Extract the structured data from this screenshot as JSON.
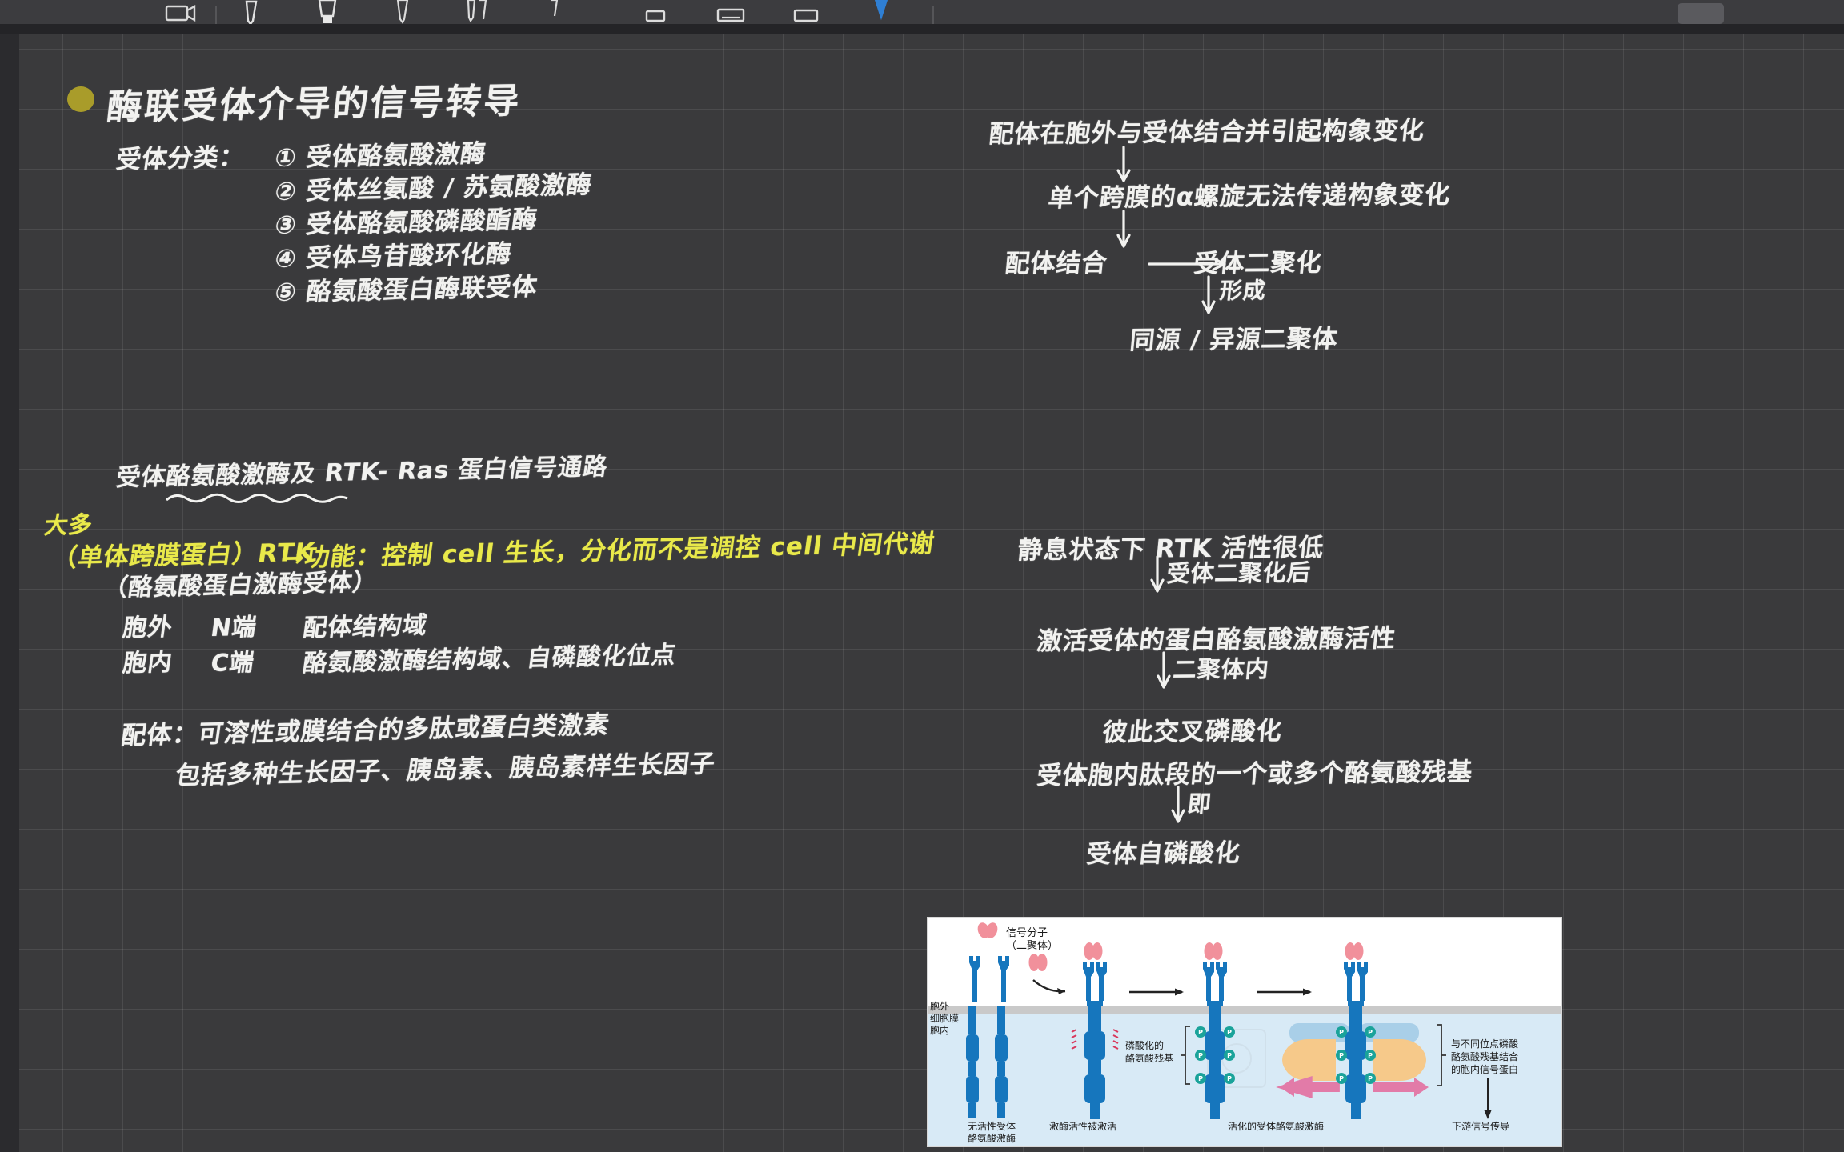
{
  "app": {
    "toolbar": {
      "tools": [
        {
          "name": "camera-icon",
          "label": "Camera"
        },
        {
          "name": "pen-icon",
          "label": "Pen"
        },
        {
          "name": "highlighter-icon",
          "label": "Highlighter"
        },
        {
          "name": "pencil-icon",
          "label": "Pencil"
        },
        {
          "name": "brush-icon",
          "label": "Brush"
        },
        {
          "name": "eraser-icon",
          "label": "Eraser"
        },
        {
          "name": "shape-square-icon",
          "label": "Shape"
        },
        {
          "name": "text-box-icon",
          "label": "Text box"
        },
        {
          "name": "note-icon",
          "label": "Sticky note"
        },
        {
          "name": "lasso-icon",
          "label": "Lasso select"
        }
      ],
      "more_button_label": ""
    },
    "canvas": {
      "background_color": "#3a3a3c",
      "grid_color": "#ffffff15",
      "ink_color": "#f2f2f0",
      "highlight_ink_color": "#e9e94a",
      "bullet_color": "#a99c2a"
    }
  },
  "note": {
    "title": "酶联受体介导的信号转导",
    "left_column": {
      "classification_label": "受体分类：",
      "classification_items": [
        "① 受体酪氨酸激酶",
        "② 受体丝氨酸 / 苏氨酸激酶",
        "③ 受体酪氨酸磷酸酯酶",
        "④ 受体鸟苷酸环化酶",
        "⑤ 酪氨酸蛋白酶联受体"
      ],
      "section_heading": "受体酪氨酸激酶及 RTK- Ras 蛋白信号通路",
      "margin_note": "大多",
      "rtk_line": "（单体跨膜蛋白）RTK",
      "rtk_function": "→功能：控制 cell 生长，分化而不是调控 cell 中间代谢",
      "rtk_subnote": "（酪氨酸蛋白激酶受体）",
      "domain_rows": [
        {
          "side": "胞外",
          "terminus": "N端",
          "desc": "配体结构域"
        },
        {
          "side": "胞内",
          "terminus": "C端",
          "desc": "酪氨酸激酶结构域、自磷酸化位点"
        }
      ],
      "ligand_line": "配体：可溶性或膜结合的多肽或蛋白类激素",
      "ligand_examples": "包括多种生长因子、胰岛素、胰岛素样生长因子"
    },
    "right_column_upper": {
      "steps": [
        "配体在胞外与受体结合并引起构象变化",
        "单个跨膜的α螺旋无法传递构象变化"
      ],
      "binding_left": "配体结合",
      "binding_right": "受体二聚化",
      "arrow_label_1": "形成",
      "dimer_result": "同源 / 异源二聚体"
    },
    "right_column_lower": {
      "lines": [
        "静息状态下 RTK 活性很低",
        "激活受体的蛋白酪氨酸激酶活性",
        "彼此交叉磷酸化",
        "受体胞内肽段的一个或多个酪氨酸残基",
        "受体自磷酸化"
      ],
      "arrow_labels": [
        "受体二聚化后",
        "二聚体内",
        "即"
      ]
    }
  },
  "diagram": {
    "caption_signal": "信号分子\n（二聚体）",
    "side_labels": "胞外\n细胞膜\n胞内",
    "annotation_phospho": "磷酸化的\n酪氨酸残基",
    "annotation_right": "与不同位点磷酸\n酪氨酸残基结合\n的胞内信号蛋白",
    "bottom_labels": [
      "无活性受体\n酪氨酸激酶",
      "激酶活性被激活",
      "活化的受体酪氨酸激酶",
      "下游信号传导"
    ],
    "p_badge": "P",
    "colors": {
      "receptor": "#1676bd",
      "ligand": "#f1909b",
      "membrane": "#c9c9c9",
      "cytosol": "#d8eaf6",
      "protein_blue": "#a9cfe8",
      "protein_orange": "#f6c98a",
      "protein_pink": "#e27ba8",
      "p_badge": "#1aa39a"
    }
  }
}
